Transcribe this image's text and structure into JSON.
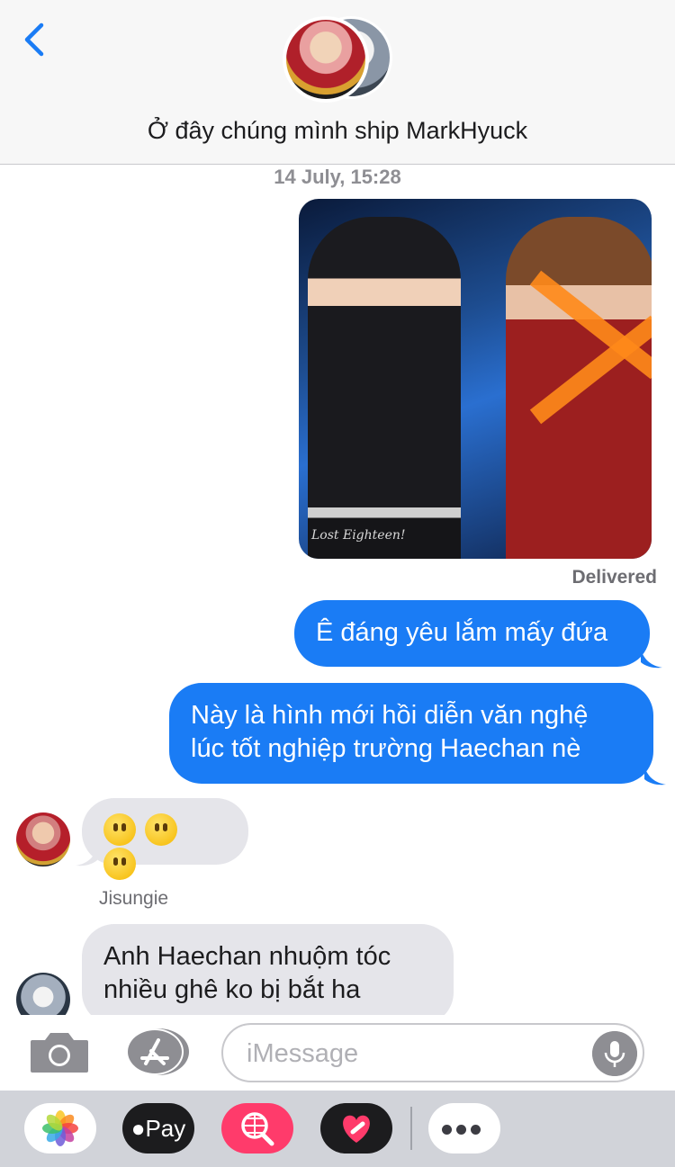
{
  "header": {
    "title": "Ở đây chúng mình ship MarkHyuck"
  },
  "timestamp": "14 July, 15:28",
  "photo": {
    "watermark": "Lost Eighteen!"
  },
  "delivered_label": "Delivered",
  "messages": [
    {
      "direction": "outgoing",
      "text": "Ê đáng yêu lắm mấy đứa"
    },
    {
      "direction": "outgoing",
      "lines": [
        "Này là hình mới hồi diễn văn nghệ",
        "lúc tốt nghiệp trường Haechan nè"
      ]
    },
    {
      "direction": "incoming",
      "emoji": [
        "😶",
        "😶",
        "😶"
      ]
    },
    {
      "direction": "incoming",
      "sender": "Jisungie",
      "lines": [
        "Anh Haechan nhuộm tóc",
        "nhiều ghê ko bị bắt ha"
      ]
    }
  ],
  "input": {
    "placeholder": "iMessage"
  },
  "drawer": {
    "apple_pay_label": "Pay"
  },
  "colors": {
    "outgoing_bubble": "#1a7cf5",
    "incoming_bubble": "#e5e5ea",
    "accent": "#1a7cf5"
  }
}
